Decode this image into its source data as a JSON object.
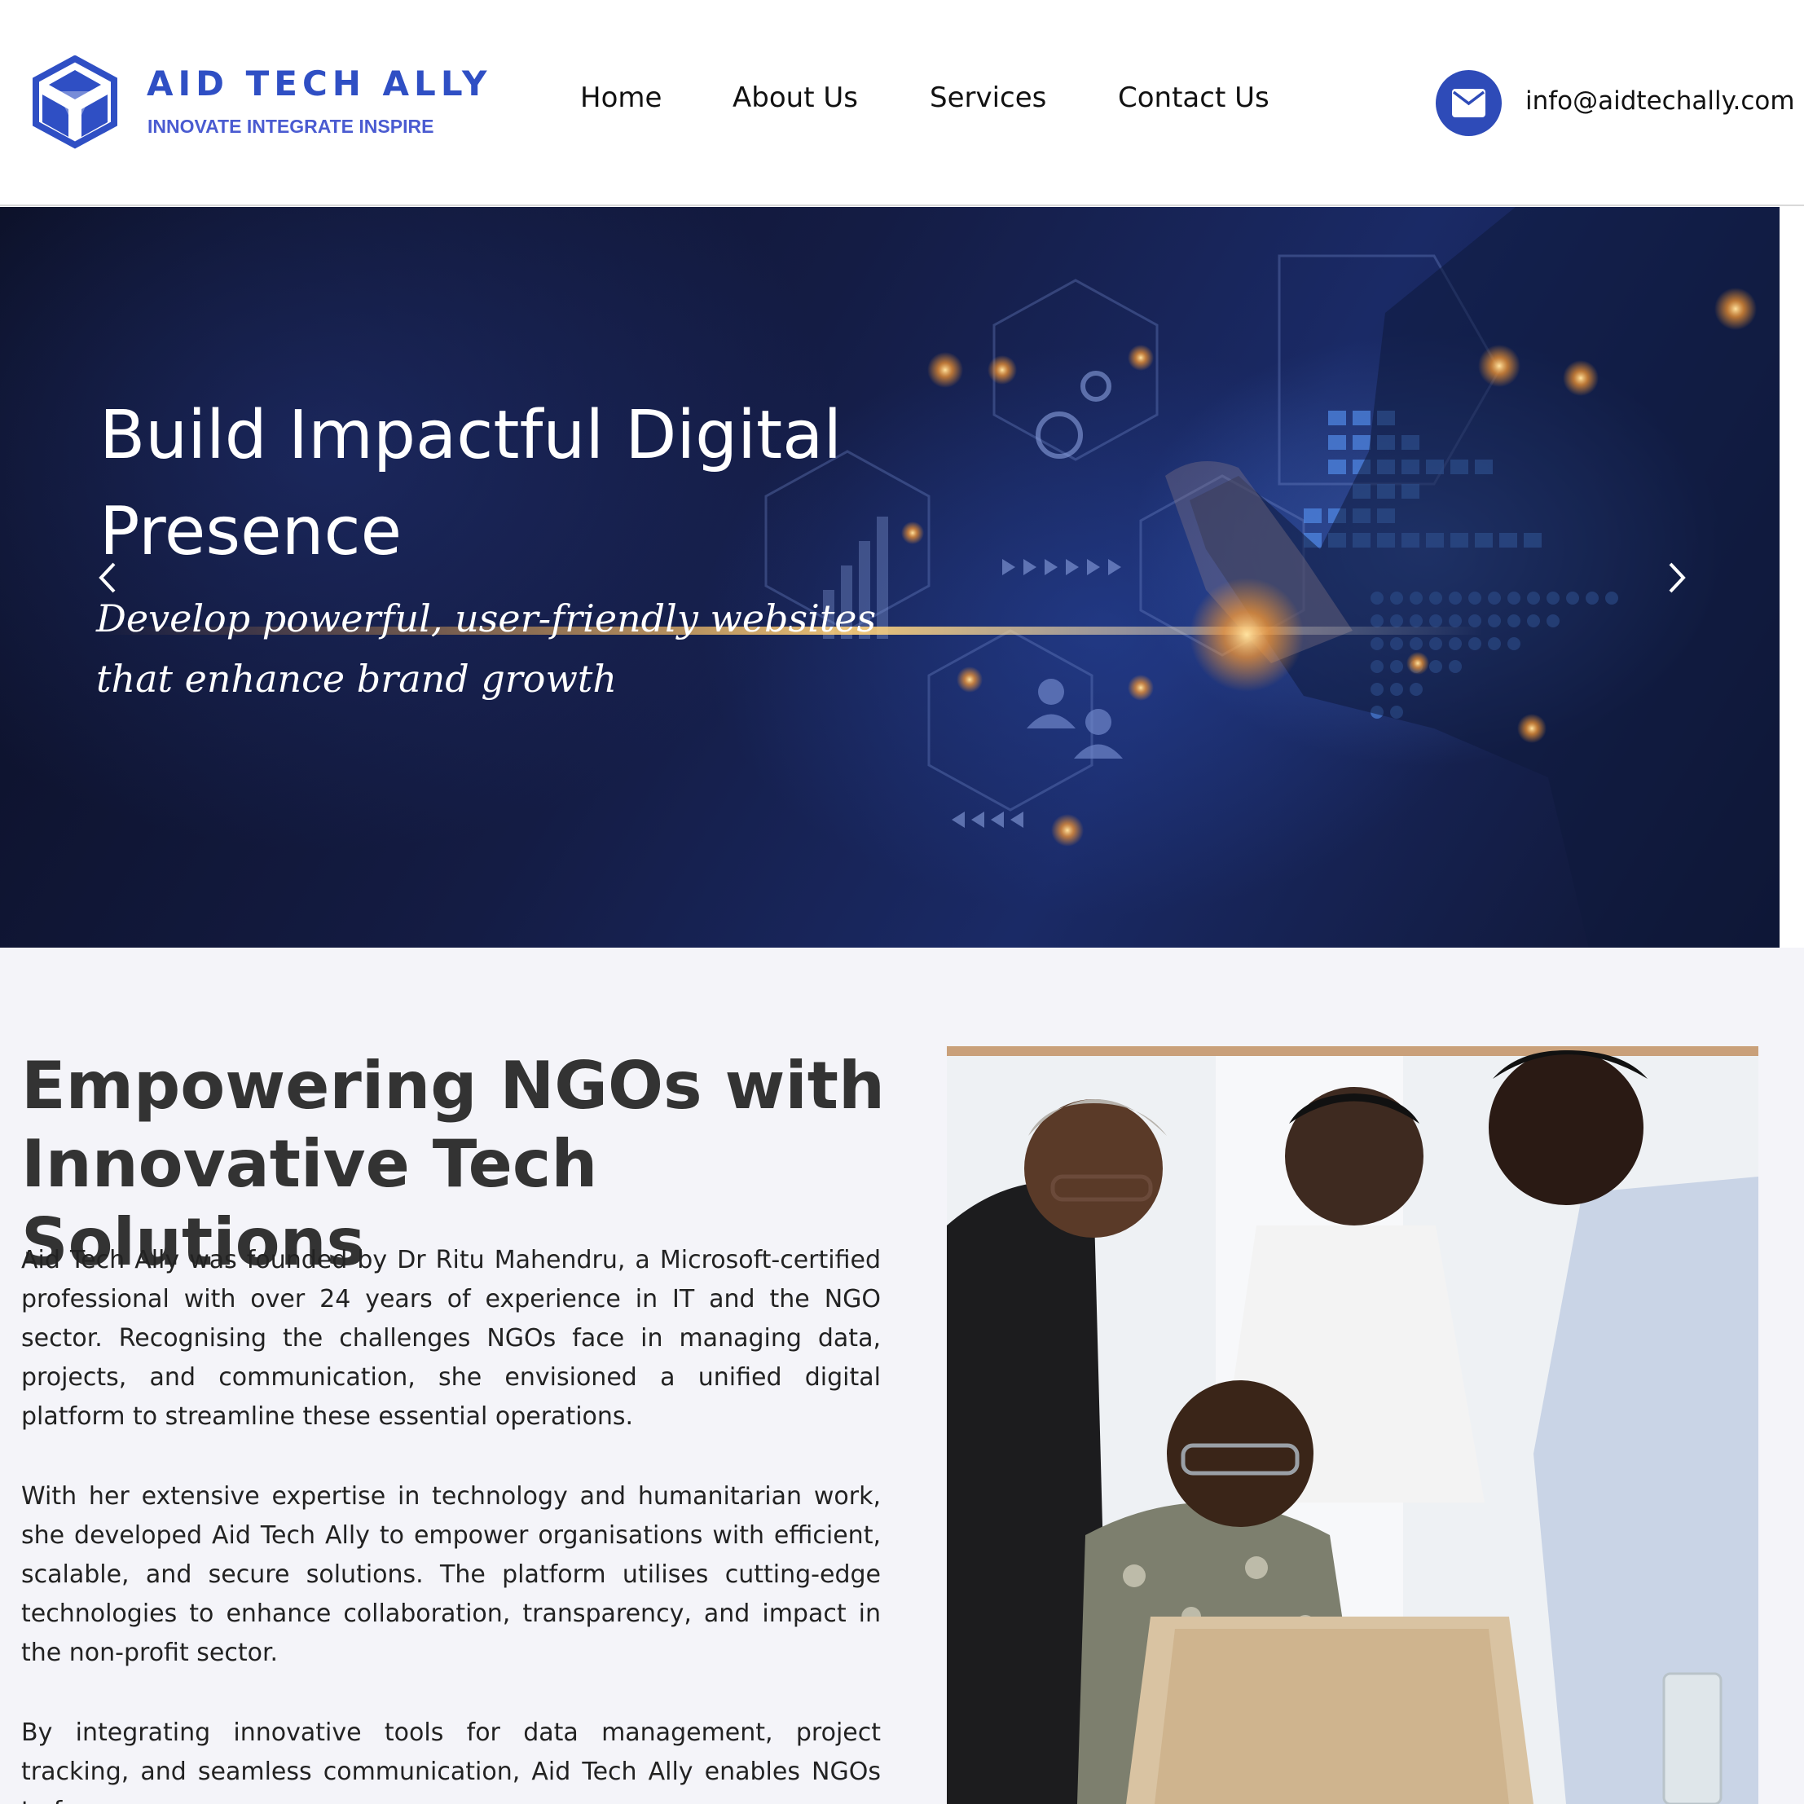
{
  "header": {
    "brand_name": "AID TECH ALLY",
    "brand_tagline": "INNOVATE INTEGRATE INSPIRE",
    "nav": [
      {
        "label": "Home"
      },
      {
        "label": "About Us"
      },
      {
        "label": "Services"
      },
      {
        "label": "Contact Us"
      }
    ],
    "email": "info@aidtechally.com"
  },
  "hero": {
    "title": "Build Impactful Digital Presence",
    "subtitle": "Develop powerful, user-friendly websites that enhance brand growth"
  },
  "about": {
    "title": "Empowering NGOs with Innovative Tech Solutions",
    "paragraphs": [
      "Aid Tech Ally was founded by Dr Ritu Mahendru, a Microsoft-certified professional with over 24 years of experience in IT and the NGO sector. Recognising the challenges NGOs face in managing data, projects, and communication, she envisioned a unified digital platform to streamline these essential operations.",
      "With her extensive expertise in technology and humanitarian work, she developed Aid Tech Ally to empower organisations with efficient, scalable, and secure solutions. The platform utilises cutting-edge technologies to enhance collaboration, transparency, and impact in the non-profit sector.",
      "By integrating innovative tools for data management, project tracking, and seamless communication, Aid Tech Ally enables NGOs to focus on"
    ]
  },
  "colors": {
    "brand_blue": "#2f4fc4",
    "mail_circle": "#2e4bb8",
    "about_bg": "#f4f4f9",
    "heading_dark": "#333333"
  },
  "icons": {
    "logo": "aid-tech-ally-logo-icon",
    "mail": "envelope-icon",
    "prev": "chevron-left-icon",
    "next": "chevron-right-icon"
  }
}
